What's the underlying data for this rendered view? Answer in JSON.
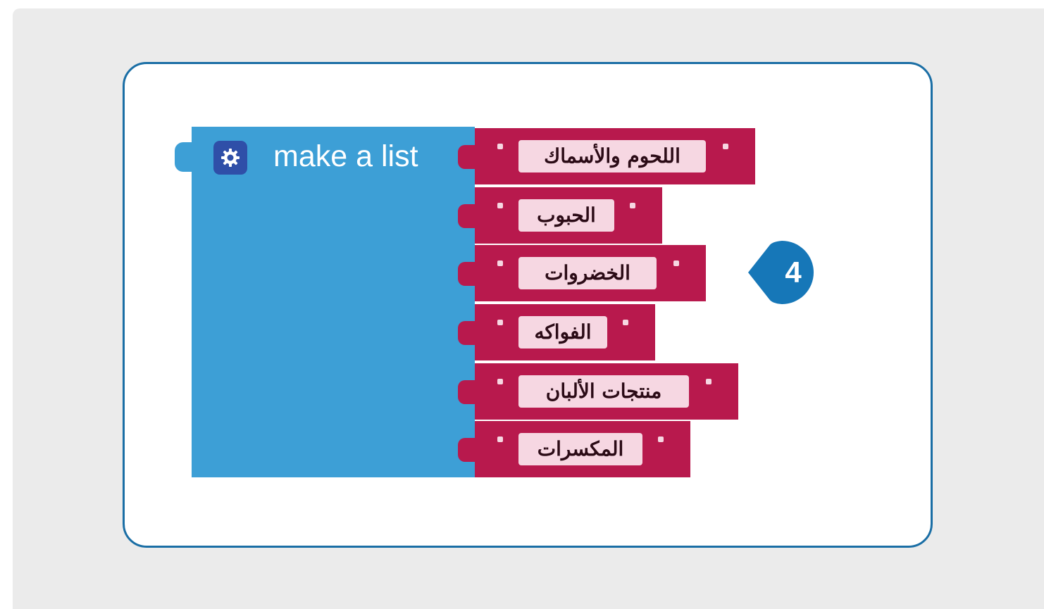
{
  "block": {
    "label": "make a list",
    "color": "#3d9fd6",
    "mutator_icon": "gear-icon"
  },
  "items": [
    {
      "text": "اللحوم والأسماك"
    },
    {
      "text": "الحبوب"
    },
    {
      "text": "الخضروات"
    },
    {
      "text": "الفواكه"
    },
    {
      "text": "منتجات الألبان"
    },
    {
      "text": "المكسرات"
    }
  ],
  "item_color": "#b8194d",
  "step_marker": {
    "number": "4",
    "color": "#1677b8"
  }
}
